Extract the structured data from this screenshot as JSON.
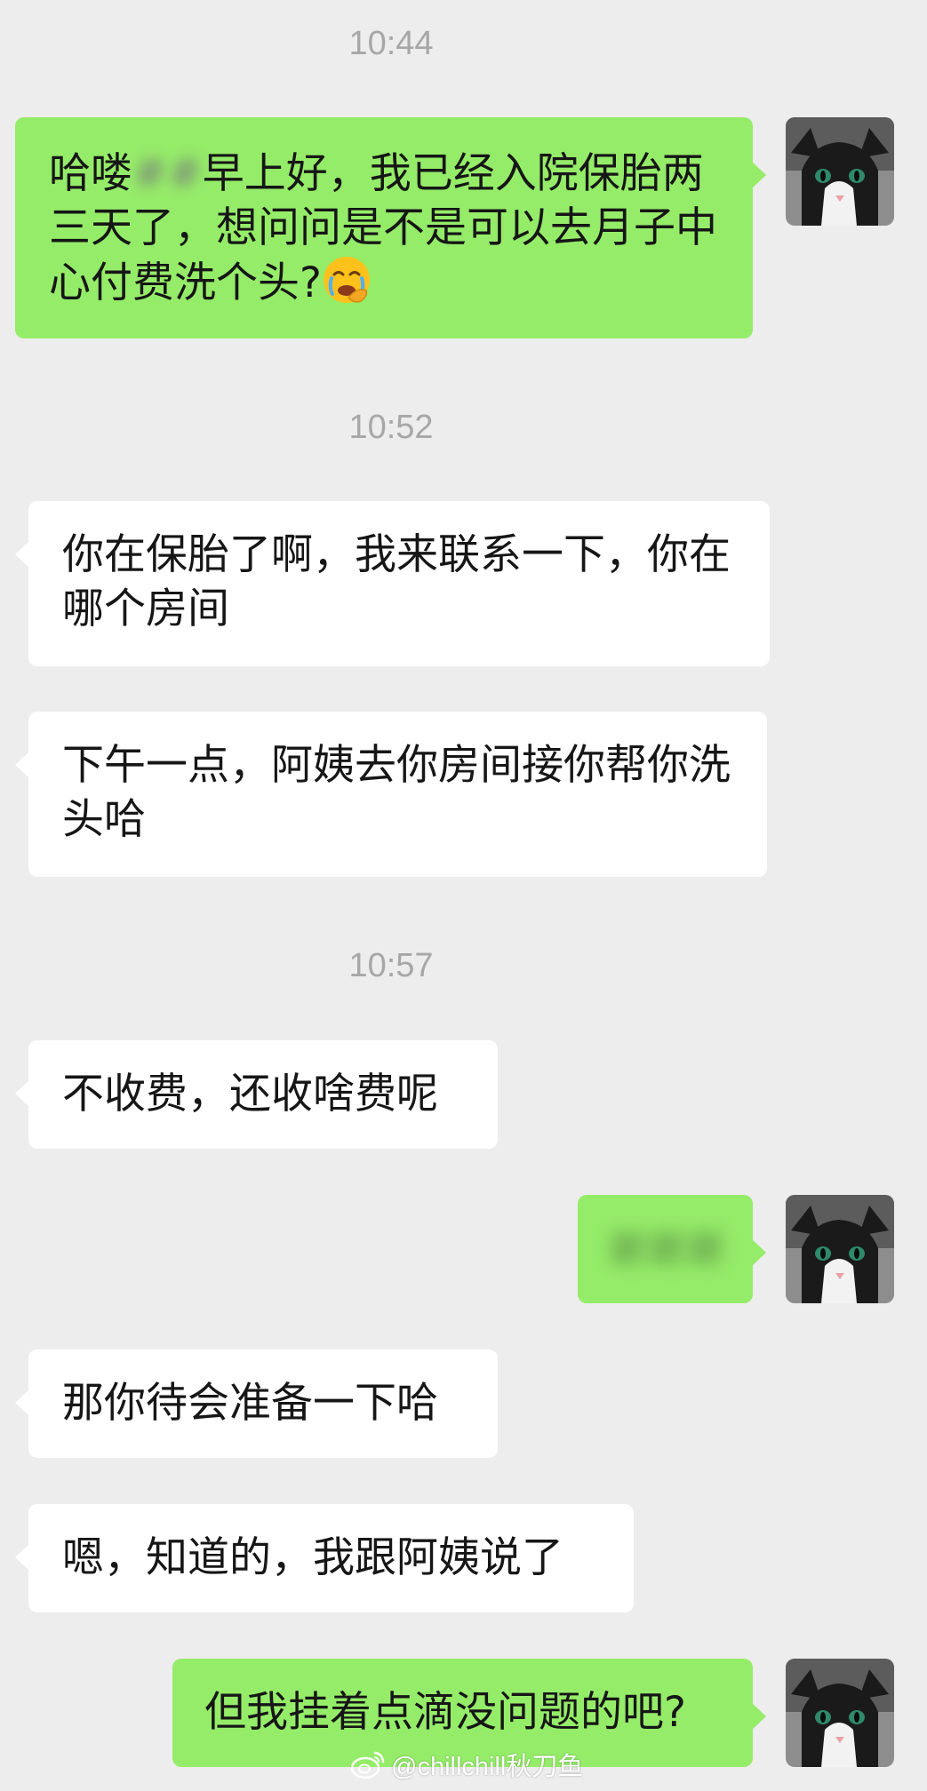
{
  "timestamps": [
    "10:44",
    "10:52",
    "10:57"
  ],
  "messages": [
    {
      "sender": "me",
      "text_before": "哈喽",
      "redacted": "##",
      "text_after": "早上好，我已经入院保胎两三天了，想问问是不是可以去月子中心付费洗个头?",
      "emoji": "face-with-hand-over-mouth-crying"
    },
    {
      "sender": "other",
      "text": "你在保胎了啊，我来联系一下，你在哪个房间"
    },
    {
      "sender": "other",
      "text": "下午一点，阿姨去你房间接你帮你洗头哈"
    },
    {
      "sender": "other",
      "text": "不收费，还收啥费呢"
    },
    {
      "sender": "me",
      "redacted": "谢谢谢"
    },
    {
      "sender": "other",
      "text": "那你待会准备一下哈"
    },
    {
      "sender": "other",
      "text": "嗯，知道的，我跟阿姨说了"
    },
    {
      "sender": "me",
      "text": "但我挂着点滴没问题的吧?"
    }
  ],
  "watermark": {
    "icon": "weibo-logo-icon",
    "text": "@chillchill秋刀鱼"
  },
  "colors": {
    "background": "#ededed",
    "sent_bubble": "#95ec69",
    "received_bubble": "#ffffff",
    "timestamp": "#a7a7a7"
  }
}
